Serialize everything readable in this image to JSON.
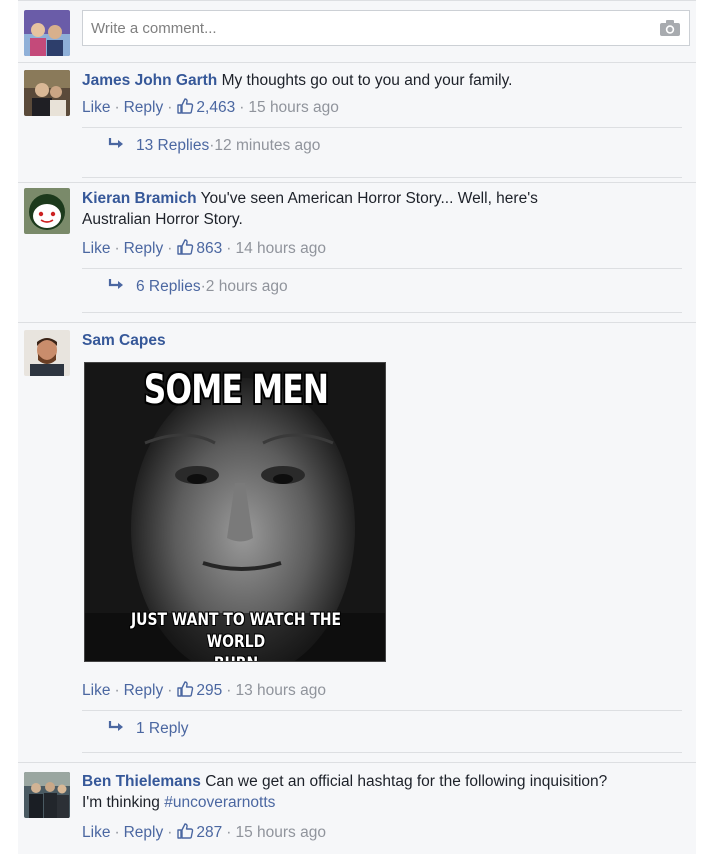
{
  "composer": {
    "placeholder": "Write a comment..."
  },
  "comments": [
    {
      "author": "James John Garth",
      "text": "My thoughts go out to you and your family.",
      "like": "Like",
      "reply": "Reply",
      "likes": "2,463",
      "time": "15 hours ago",
      "replies": {
        "label": "13 Replies",
        "time": "12 minutes ago"
      }
    },
    {
      "author": "Kieran Bramich",
      "text_line1": "You've seen American Horror Story... Well, here's",
      "text_line2": "Australian Horror Story.",
      "like": "Like",
      "reply": "Reply",
      "likes": "863",
      "time": "14 hours ago",
      "replies": {
        "label": "6 Replies",
        "time": "2 hours ago"
      }
    },
    {
      "author": "Sam Capes",
      "meme": {
        "top": "SOME MEN",
        "bottom_line1": "JUST WANT TO WATCH THE WORLD",
        "bottom_line2": "BURN"
      },
      "like": "Like",
      "reply": "Reply",
      "likes": "295",
      "time": "13 hours ago",
      "replies": {
        "label": "1 Reply"
      }
    },
    {
      "author": "Ben Thielemans",
      "text_line1": "Can we get an official hashtag for the following inquisition?",
      "text_line2_prefix": "I'm thinking",
      "hashtag": "#uncoverarnotts",
      "like": "Like",
      "reply": "Reply",
      "likes": "287",
      "time": "15 hours ago"
    }
  ],
  "separator": "·",
  "colors": {
    "link": "#365899",
    "meta": "#90949c",
    "background": "#f6f7f9"
  }
}
